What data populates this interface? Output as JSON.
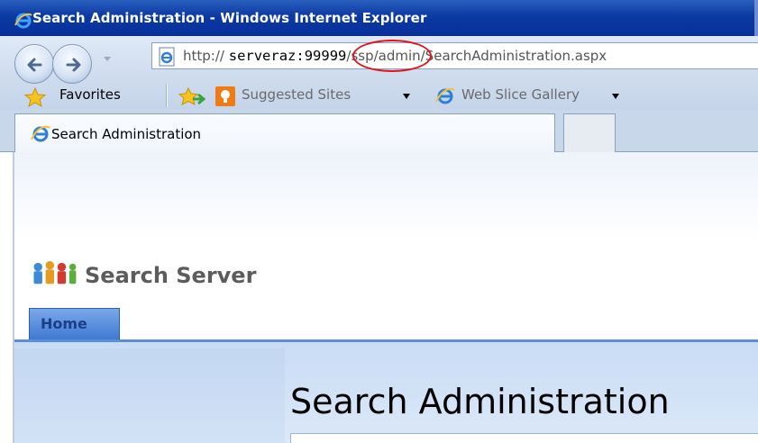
{
  "window": {
    "title": "Search Administration - Windows Internet Explorer"
  },
  "address_bar": {
    "url_prefix": "http://",
    "url_host": "serveraz",
    "url_port": ":99999",
    "url_path": "/ssp/admin/SearchAdministration.aspx",
    "highlighted_segment": ":99999",
    "highlight_color": "#e0151b"
  },
  "favorites_bar": {
    "favorites_label": "Favorites",
    "suggested_sites_label": "Suggested Sites",
    "web_slice_gallery_label": "Web Slice Gallery"
  },
  "tabs": [
    {
      "label": "Search Administration",
      "active": true
    }
  ],
  "page": {
    "site_title": "Search Server",
    "nav_tabs": [
      {
        "label": "Home"
      }
    ],
    "heading": "Search Administration"
  },
  "colors": {
    "titlebar": "#0b3aa3",
    "nav_accent": "#5d8fd6",
    "content_band": "#c9dcf5"
  },
  "icons": [
    "ie-icon",
    "back-arrow-icon",
    "forward-arrow-icon",
    "dropdown-arrow-icon",
    "page-icon",
    "favorites-star-icon",
    "add-favorites-icon",
    "suggested-sites-icon",
    "web-slice-icon",
    "sharepoint-people-icon"
  ]
}
